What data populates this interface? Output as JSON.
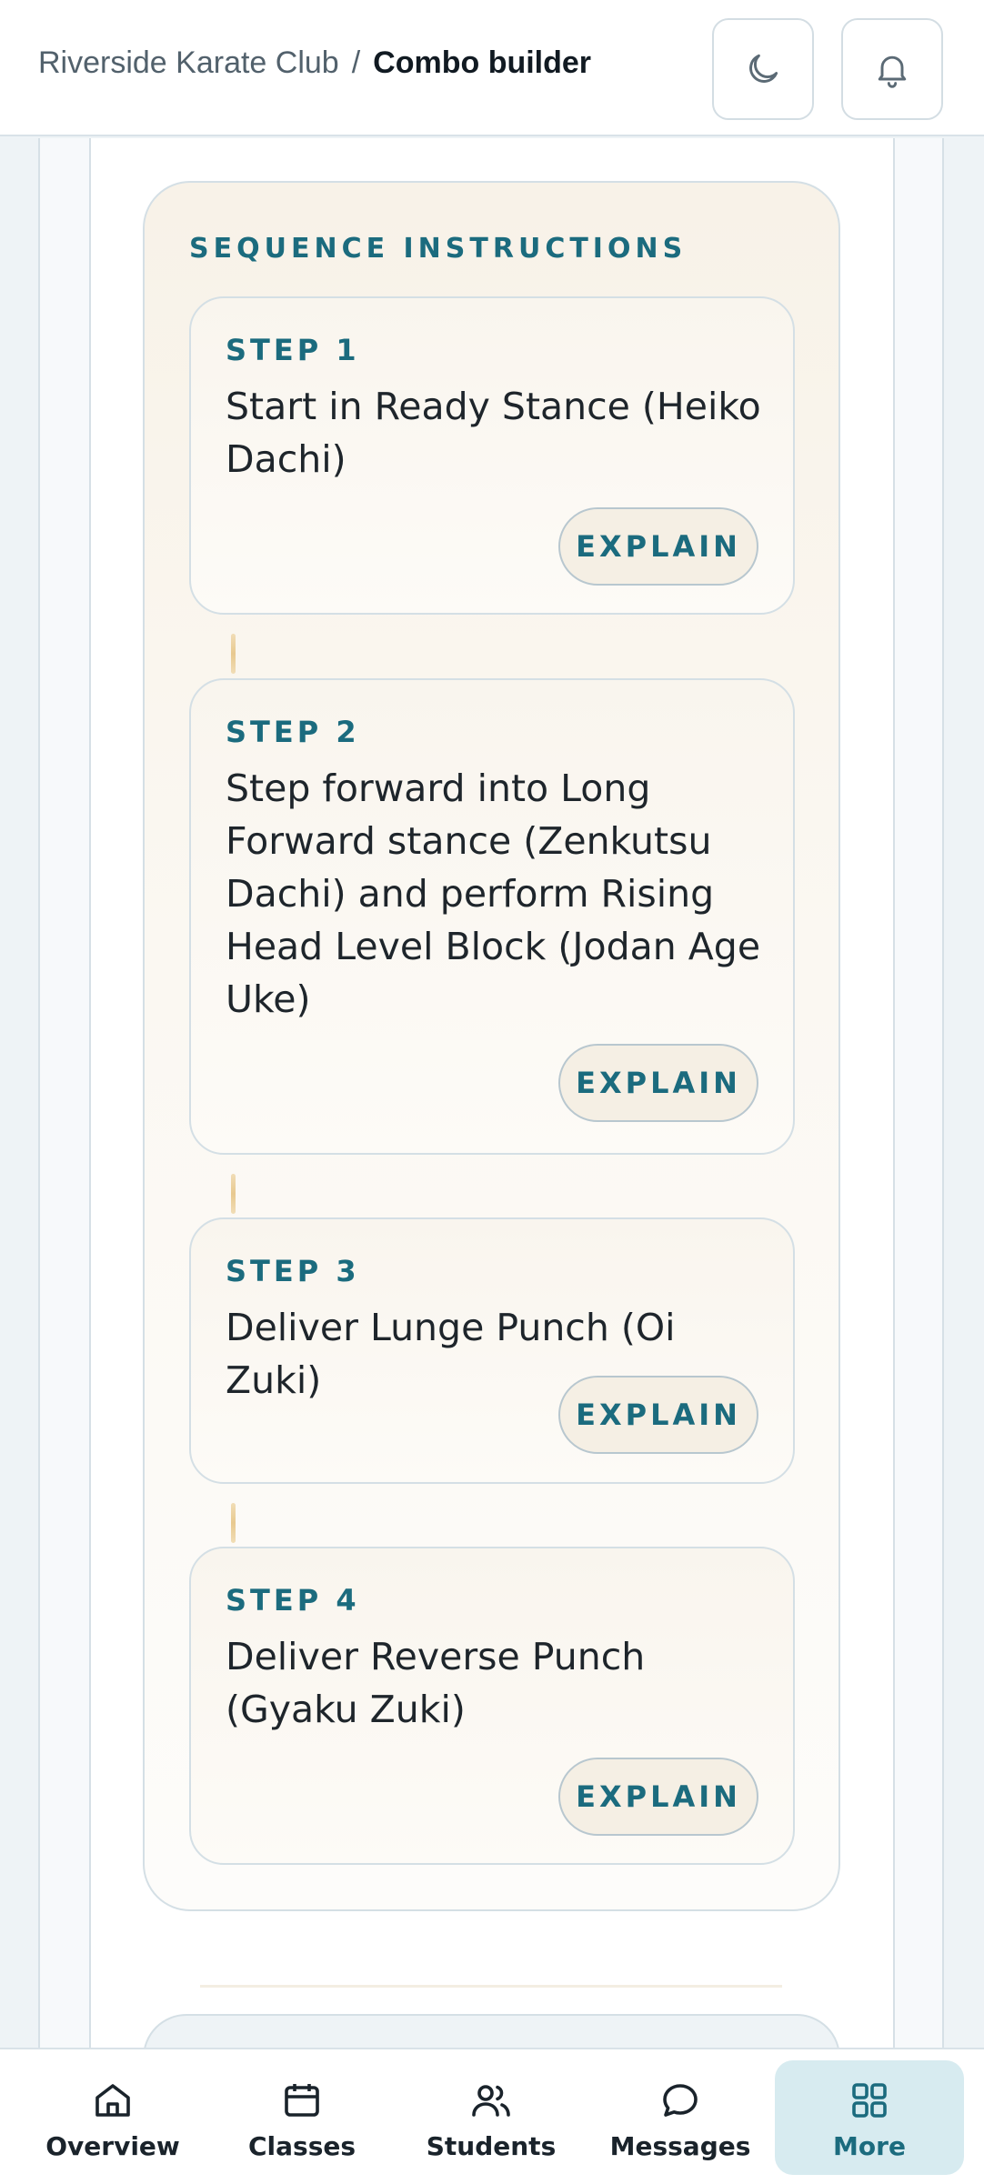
{
  "header": {
    "breadcrumb_parent": "Riverside Karate Club",
    "breadcrumb_separator": "/",
    "breadcrumb_current": "Combo builder",
    "theme_icon": "moon-icon",
    "notifications_icon": "bell-icon"
  },
  "sequence": {
    "title": "SEQUENCE INSTRUCTIONS",
    "steps": [
      {
        "label": "STEP 1",
        "text": "Start in Ready Stance (Heiko Dachi)",
        "button": "EXPLAIN"
      },
      {
        "label": "STEP 2",
        "text": "Step forward into Long Forward stance (Zenkutsu Dachi) and perform Rising Head Level Block (Jodan Age Uke)",
        "button": "EXPLAIN"
      },
      {
        "label": "STEP 3",
        "text": "Deliver Lunge Punch (Oi Zuki)",
        "button": "EXPLAIN"
      },
      {
        "label": "STEP 4",
        "text": "Deliver Reverse Punch (Gyaku Zuki)",
        "button": "EXPLAIN"
      }
    ]
  },
  "nav": {
    "items": [
      {
        "label": "Overview",
        "icon": "home-icon"
      },
      {
        "label": "Classes",
        "icon": "calendar-icon"
      },
      {
        "label": "Students",
        "icon": "users-icon"
      },
      {
        "label": "Messages",
        "icon": "chat-icon"
      },
      {
        "label": "More",
        "icon": "grid-icon",
        "active": true
      }
    ]
  },
  "colors": {
    "accent": "#1b6b7e",
    "active_nav_bg": "#d7ebf0",
    "connector": "#e8c98f"
  }
}
